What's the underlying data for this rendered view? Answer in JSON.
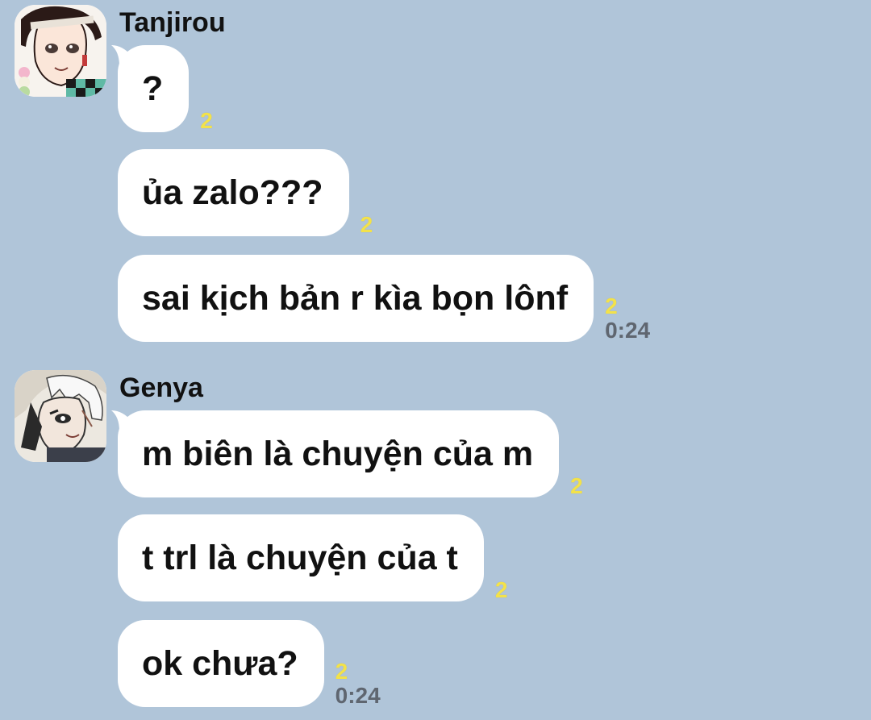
{
  "theme": {
    "background": "#b0c5d9",
    "bubble": "#ffffff",
    "read_receipt": "#f3e24a",
    "timestamp": "#5f6670"
  },
  "groups": [
    {
      "sender": "Tanjirou",
      "avatar_icon": "tanjirou-avatar",
      "messages": [
        {
          "text": "?",
          "read": "2",
          "time": ""
        },
        {
          "text": "ủa zalo???",
          "read": "2",
          "time": ""
        },
        {
          "text": "sai kịch bản r kìa bọn lônf",
          "read": "2",
          "time": "0:24"
        }
      ]
    },
    {
      "sender": "Genya",
      "avatar_icon": "genya-avatar",
      "messages": [
        {
          "text": "m biên là chuyện của m",
          "read": "2",
          "time": ""
        },
        {
          "text": "t trl là chuyện của t",
          "read": "2",
          "time": ""
        },
        {
          "text": "ok chưa?",
          "read": "2",
          "time": "0:24"
        }
      ]
    }
  ]
}
